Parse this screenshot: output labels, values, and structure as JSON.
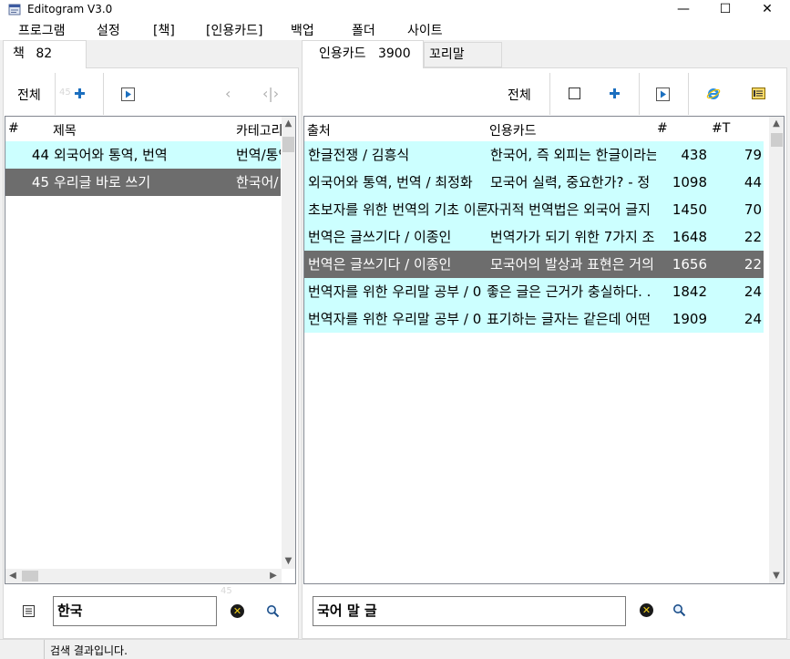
{
  "window": {
    "title": "Editogram V3.0",
    "controls": {
      "minimize": "—",
      "maximize": "☐",
      "close": "✕"
    }
  },
  "menu": [
    "프로그램",
    "설정",
    "[책]",
    "[인용카드]",
    "백업",
    "폴더",
    "사이트"
  ],
  "left_tab": {
    "label": "책",
    "count": "82"
  },
  "right_tabs": {
    "active_label": "인용카드",
    "active_count": "3900",
    "inactive_label": "꼬리말"
  },
  "left_toolbar": {
    "all_label": "전체",
    "faded_number": "45"
  },
  "right_toolbar": {
    "all_label": "전체"
  },
  "books_table": {
    "headers": [
      "#",
      "제목",
      "카테고리"
    ],
    "rows": [
      {
        "num": "44",
        "title": "외국어와 통역, 번역",
        "category": "번역/통역",
        "state": "normal"
      },
      {
        "num": "45",
        "title": "우리글 바로 쓰기",
        "category": "한국어/",
        "state": "selected"
      }
    ]
  },
  "cards_table": {
    "headers": [
      "출처",
      "인용카드",
      "#",
      "#T"
    ],
    "rows": [
      {
        "source": "한글전쟁 / 김흥식",
        "card": "한국어, 즉 외피는 한글이라는",
        "num": "438",
        "t": "79",
        "state": "normal"
      },
      {
        "source": "외국어와 통역, 번역 / 최정화",
        "card": "모국어 실력, 중요한가? - 정",
        "num": "1098",
        "t": "44",
        "state": "normal"
      },
      {
        "source": "초보자를 위한 번역의 기초 이론",
        "card": "자귀적 번역법은 외국어 글지",
        "num": "1450",
        "t": "70",
        "state": "normal"
      },
      {
        "source": "번역은 글쓰기다 / 이종인",
        "card": "번역가가 되기 위한 7가지 조",
        "num": "1648",
        "t": "22",
        "state": "normal"
      },
      {
        "source": "번역은 글쓰기다 / 이종인",
        "card": "모국어의 발상과 표현은 거의",
        "num": "1656",
        "t": "22",
        "state": "selected"
      },
      {
        "source": "번역자를 위한 우리말 공부 / 0",
        "card": "좋은 글은 근거가 충실하다. .",
        "num": "1842",
        "t": "24",
        "state": "normal"
      },
      {
        "source": "번역자를 위한 우리말 공부 / 0",
        "card": "표기하는 글자는 같은데 어떤",
        "num": "1909",
        "t": "24",
        "state": "normal"
      }
    ]
  },
  "left_search": {
    "value": "한국",
    "faded_number": "45"
  },
  "right_search": {
    "value": "국어 말 글"
  },
  "status": {
    "text": "검색 결과입니다."
  },
  "colors": {
    "row_match": "#ccffff",
    "row_selected": "#6d6d6d",
    "accent_blue": "#1c6fbf"
  }
}
